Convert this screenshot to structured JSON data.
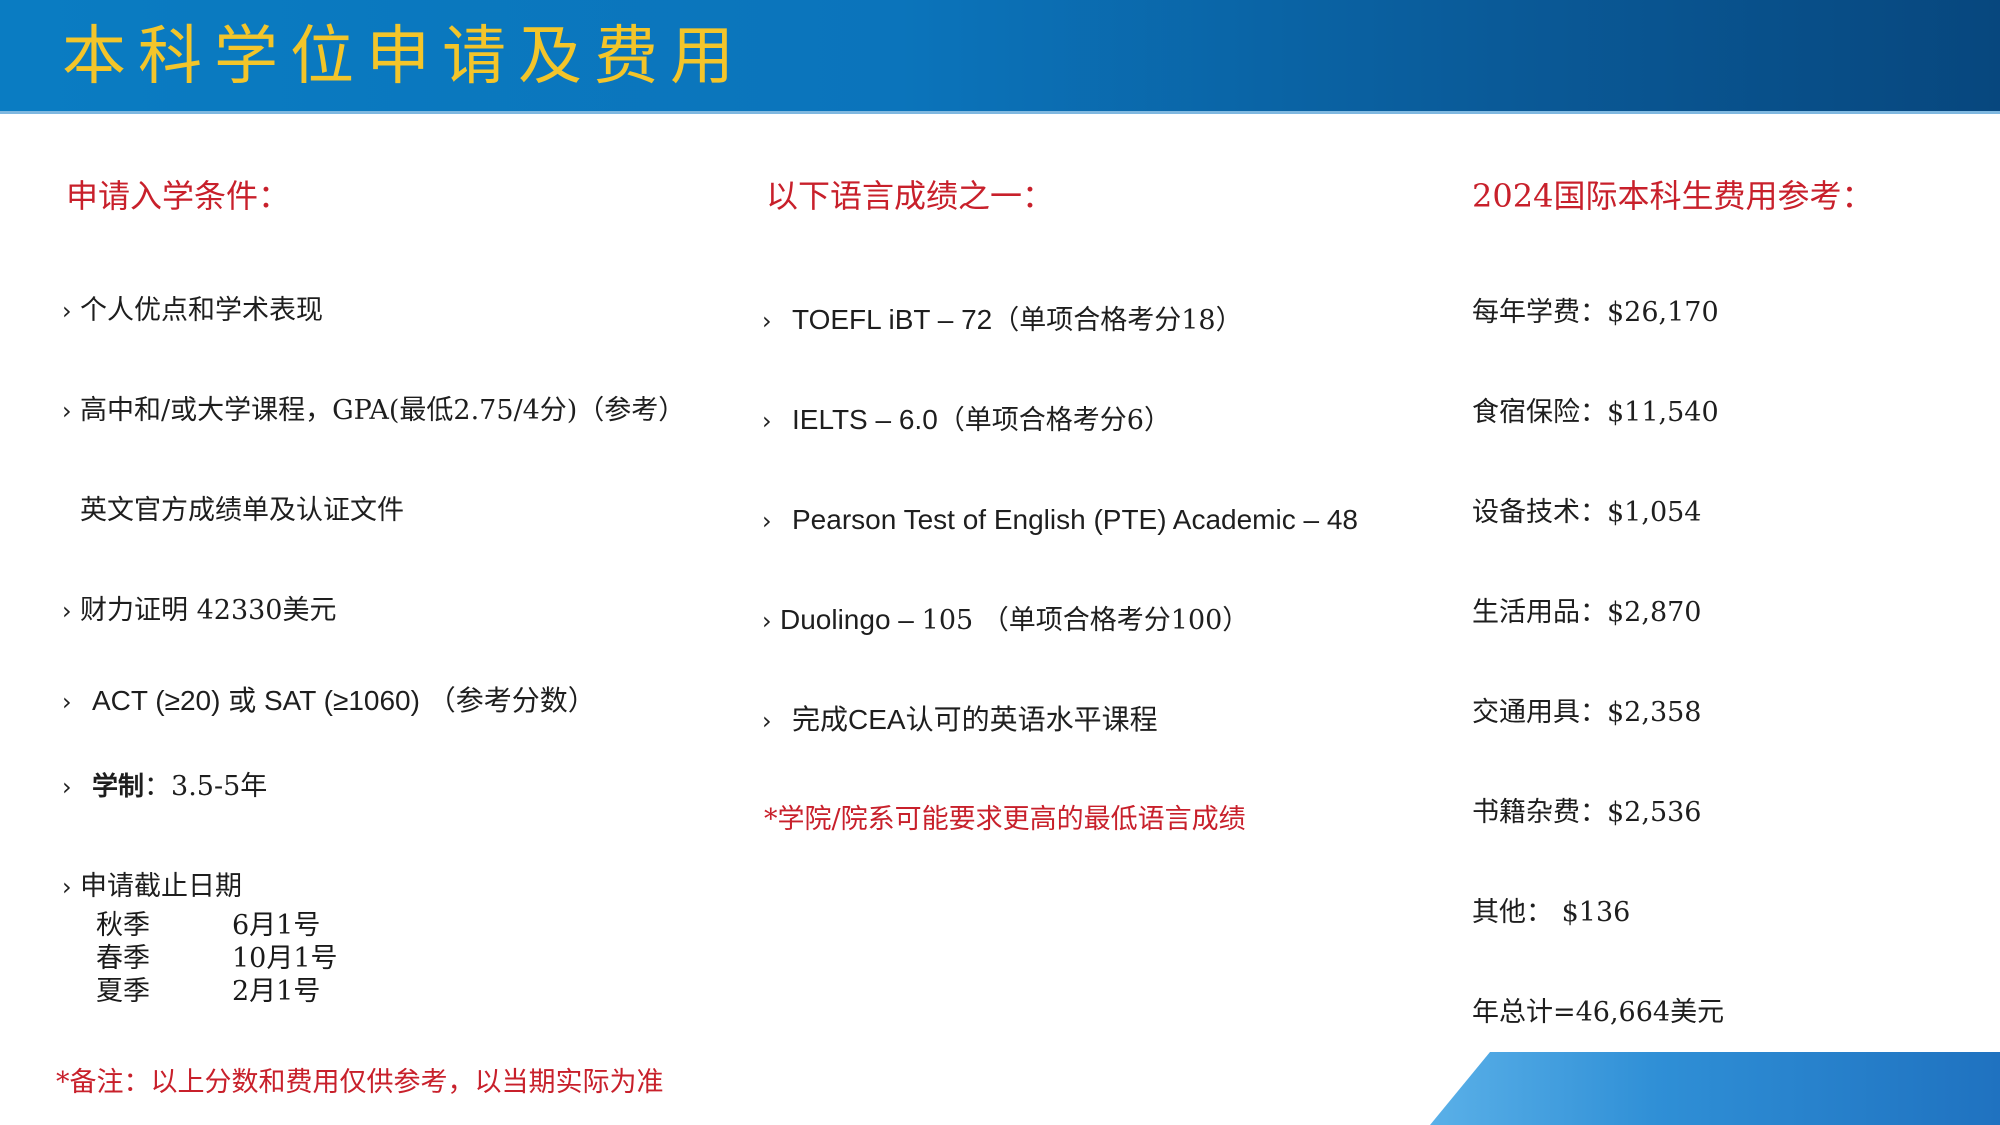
{
  "title": "本科学位申请及费用",
  "left": {
    "heading": "申请入学条件：",
    "items": [
      "个人优点和学术表现",
      "高中和/或大学课程，GPA(最低2.75/4分)（参考）",
      "英文官方成绩单及认证文件",
      "财力证明 42330美元",
      "ACT (≥20) 或 SAT (≥1060) （参考分数）"
    ],
    "duration_label": "学制",
    "duration_value": "：3.5-5年",
    "deadline_heading": "申请截止日期",
    "deadlines": [
      {
        "season": "秋季",
        "date": "6月1号"
      },
      {
        "season": "春季",
        "date": "10月1号"
      },
      {
        "season": "夏季",
        "date": "2月1号"
      }
    ],
    "note": "*备注：以上分数和费用仅供参考，以当期实际为准"
  },
  "middle": {
    "heading": "以下语言成绩之一：",
    "items": [
      {
        "main": "TOEFL iBT – 72",
        "sub": "（单项合格考分18）"
      },
      {
        "main": "IELTS – 6.0",
        "sub": "（单项合格考分6）"
      },
      {
        "main": "Pearson Test of English (PTE) Academic – 48",
        "sub": ""
      },
      {
        "main": "Duolingo – ",
        "sub": "105 （单项合格考分100）"
      },
      {
        "main": "完成CEA认可的英语水平课程",
        "sub": ""
      }
    ],
    "note": "*学院/院系可能要求更高的最低语言成绩"
  },
  "right": {
    "heading": "2024国际本科生费用参考：",
    "fees": [
      "每年学费：$26,170",
      "食宿保险：$11,540",
      "设备技术：$1,054",
      "生活用品：$2,870",
      "交通用具：$2,358",
      "书籍杂费：$2,536",
      "其他： $136",
      "年总计=46,664美元"
    ]
  },
  "colors": {
    "banner": "#0a7cc2",
    "title": "#f3c52a",
    "heading": "#c8202b"
  }
}
